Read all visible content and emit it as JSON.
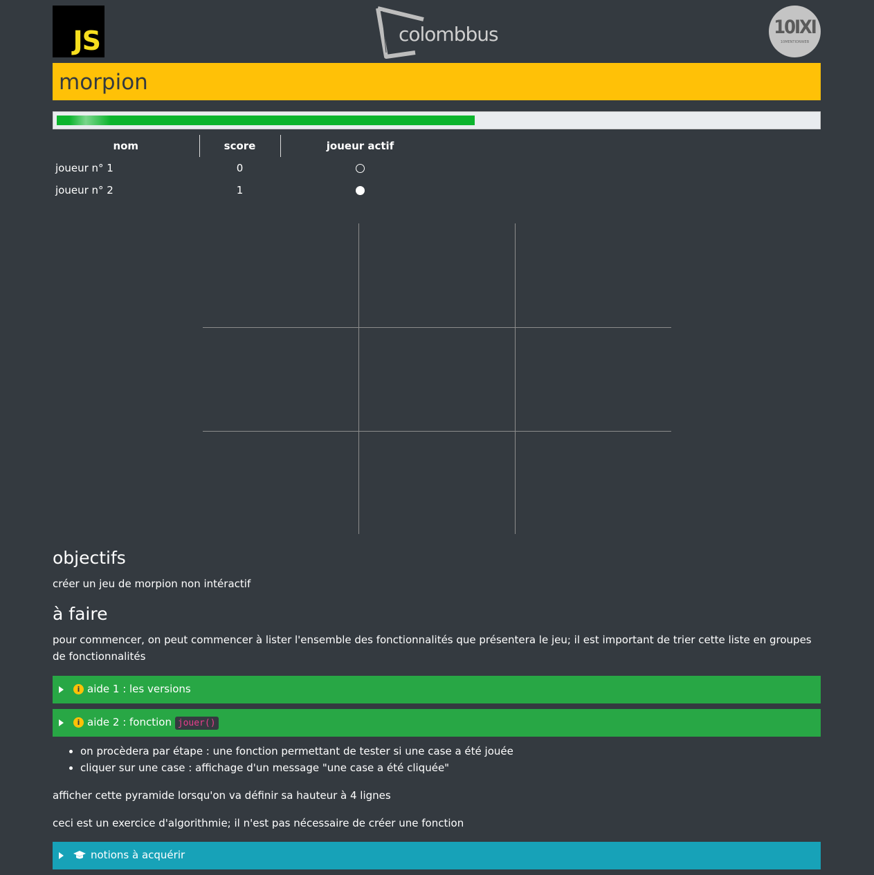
{
  "header": {
    "js_logo_text": "JS",
    "center_logo_text": "colombbus",
    "badge_big": "10IXI",
    "badge_small": "10MENTIONWEB"
  },
  "page_title": "morpion",
  "progress_percent": 55,
  "players_table": {
    "headers": [
      "nom",
      "score",
      "joueur actif"
    ],
    "rows": [
      {
        "nom": "joueur n° 1",
        "score": "0",
        "active": false
      },
      {
        "nom": "joueur n° 2",
        "score": "1",
        "active": true
      }
    ]
  },
  "board": {
    "cells": [
      "",
      "",
      "",
      "",
      "",
      "",
      "",
      "",
      ""
    ]
  },
  "objectifs": {
    "heading": "objectifs",
    "text": "créer un jeu de morpion non intéractif"
  },
  "a_faire": {
    "heading": "à faire",
    "text": "pour commencer, on peut commencer à lister l'ensemble des fonctionnalités que présentera le jeu; il est important de trier cette liste en groupes de fonctionnalités"
  },
  "aide1": {
    "label": "aide 1 : les versions",
    "info_glyph": "i"
  },
  "aide2": {
    "label": "aide 2 : fonction",
    "code": "jouer()",
    "info_glyph": "i"
  },
  "steps": [
    "on procèdera par étape : une fonction permettant de tester si une case a été jouée",
    "cliquer sur une case : affichage d'un message \"une case a été cliquée\""
  ],
  "para1": "afficher cette pyramide lorsqu'on va définir sa hauteur à 4 lignes",
  "para2": "ceci est un exercice d'algorithmie; il n'est pas nécessaire de créer une fonction",
  "notions": {
    "label": "notions à acquérir",
    "icon": "graduation-cap-icon"
  },
  "colors": {
    "background": "#343a40",
    "title_bar": "#ffc107",
    "progress_fill": "#0cb42d",
    "accordion_green": "#28a745",
    "accordion_teal": "#17a2b8"
  }
}
